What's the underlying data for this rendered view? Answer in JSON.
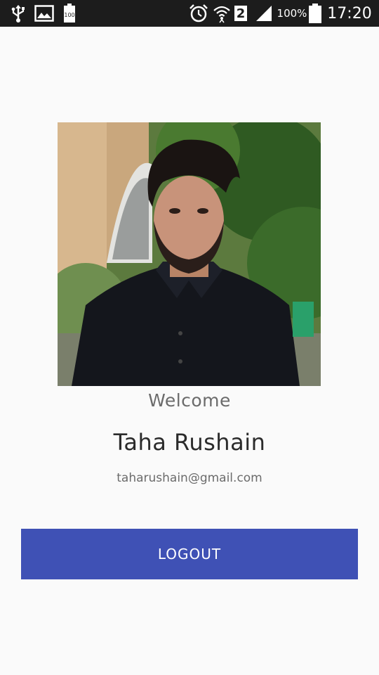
{
  "status_bar": {
    "time": "17:20",
    "battery_percent": "100%",
    "sim_slot": "2",
    "battery_small_label": "100",
    "icons": [
      "usb-icon",
      "image-icon",
      "battery-small-icon",
      "alarm-icon",
      "wifi-icon",
      "sim-icon",
      "signal-icon",
      "battery-icon"
    ]
  },
  "profile": {
    "welcome_label": "Welcome",
    "name": "Taha Rushain",
    "email": "taharushain@gmail.com"
  },
  "actions": {
    "logout_label": "LOGOUT"
  },
  "colors": {
    "statusbar_bg": "#1c1c1c",
    "background": "#fafafa",
    "button": "#3f51b5"
  }
}
